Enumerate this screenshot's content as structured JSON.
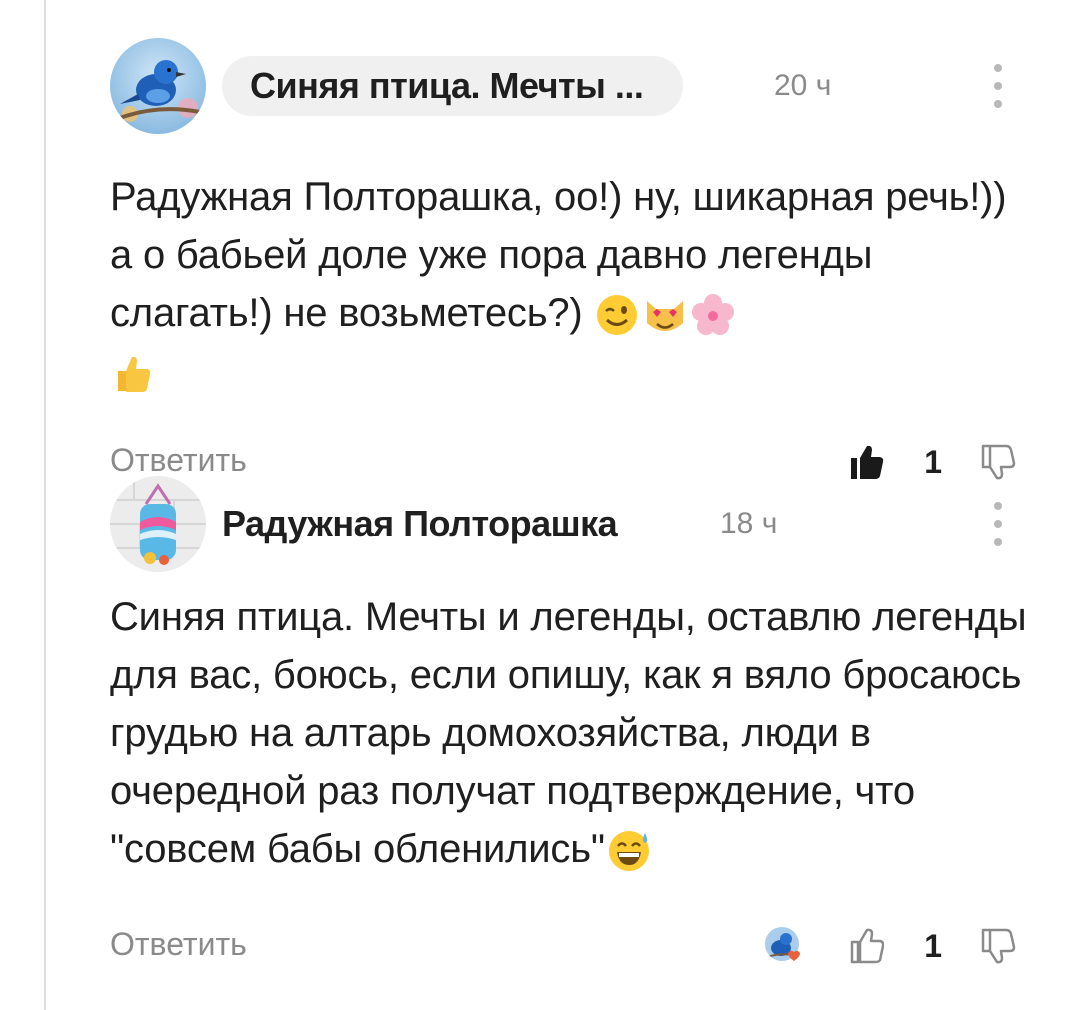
{
  "comments": [
    {
      "author": "Синяя птица. Мечты ...",
      "time": "20 ч",
      "text": "Радужная Полторашка, оо!) ну, шикарная речь!)) а о бабьей доле уже пора давно легенды слагать!) не возьметесь?)",
      "emojis": [
        "winking-face",
        "smiling-cat-heart-eyes",
        "cherry-blossom",
        "thumbs-up"
      ],
      "reply_label": "Ответить",
      "likes": "1",
      "liked": true
    },
    {
      "author": "Радужная Полторашка",
      "time": "18 ч",
      "text": "Синяя птица. Мечты и легенды, оставлю легенды для вас, боюсь, если опишу, как я вяло бросаюсь грудью на алтарь домохозяйства, люди в очередной раз получат подтверждение, что \"совсем бабы обленились\"",
      "emojis": [
        "grinning-face-with-sweat"
      ],
      "reply_label": "Ответить",
      "likes": "1",
      "liked": false
    }
  ],
  "colors": {
    "thread_line": "#dcdcdc",
    "muted_text": "#8a8a8a",
    "pill_background": "#f0f0f0",
    "heart_badge": "#e8603c"
  }
}
